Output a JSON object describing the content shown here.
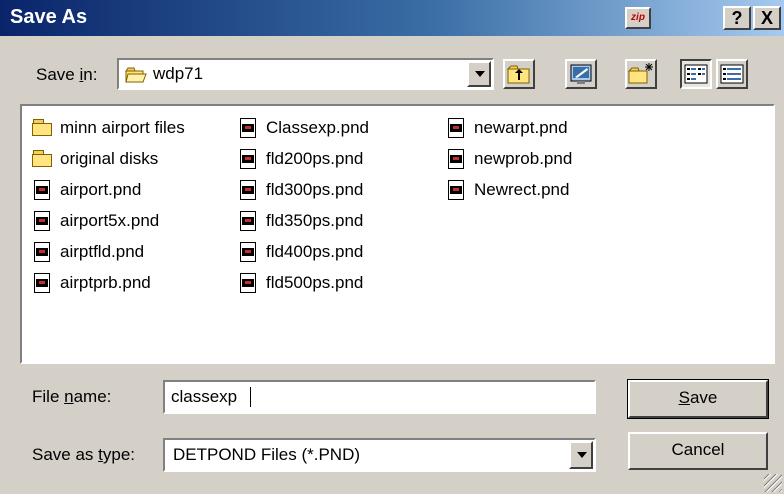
{
  "window": {
    "title": "Save As",
    "zip_label": "zip",
    "help_label": "?",
    "close_label": "X"
  },
  "save_in": {
    "label_pre": "Save ",
    "label_accel": "i",
    "label_post": "n:",
    "value": "wdp71"
  },
  "toolbar": {
    "icons": [
      "up-one-level-icon",
      "desktop-icon",
      "new-folder-icon",
      "list-view-icon",
      "details-view-icon"
    ]
  },
  "files": {
    "columns": [
      [
        {
          "name": "minn airport files",
          "kind": "folder"
        },
        {
          "name": "original disks",
          "kind": "folder"
        },
        {
          "name": "airport.pnd",
          "kind": "pnd"
        },
        {
          "name": "airport5x.pnd",
          "kind": "pnd"
        },
        {
          "name": "airptfld.pnd",
          "kind": "pnd"
        },
        {
          "name": "airptprb.pnd",
          "kind": "pnd"
        }
      ],
      [
        {
          "name": "Classexp.pnd",
          "kind": "pnd"
        },
        {
          "name": "fld200ps.pnd",
          "kind": "pnd"
        },
        {
          "name": "fld300ps.pnd",
          "kind": "pnd"
        },
        {
          "name": "fld350ps.pnd",
          "kind": "pnd"
        },
        {
          "name": "fld400ps.pnd",
          "kind": "pnd"
        },
        {
          "name": "fld500ps.pnd",
          "kind": "pnd"
        }
      ],
      [
        {
          "name": "newarpt.pnd",
          "kind": "pnd"
        },
        {
          "name": "newprob.pnd",
          "kind": "pnd"
        },
        {
          "name": "Newrect.pnd",
          "kind": "pnd"
        }
      ]
    ]
  },
  "file_name": {
    "label_pre": "File ",
    "label_accel": "n",
    "label_post": "ame:",
    "value": "classexp"
  },
  "save_as_type": {
    "label_pre": "Save as ",
    "label_accel": "t",
    "label_post": "ype:",
    "value": "DETPOND Files (*.PND)"
  },
  "buttons": {
    "save_accel": "S",
    "save_rest": "ave",
    "cancel": "Cancel"
  }
}
